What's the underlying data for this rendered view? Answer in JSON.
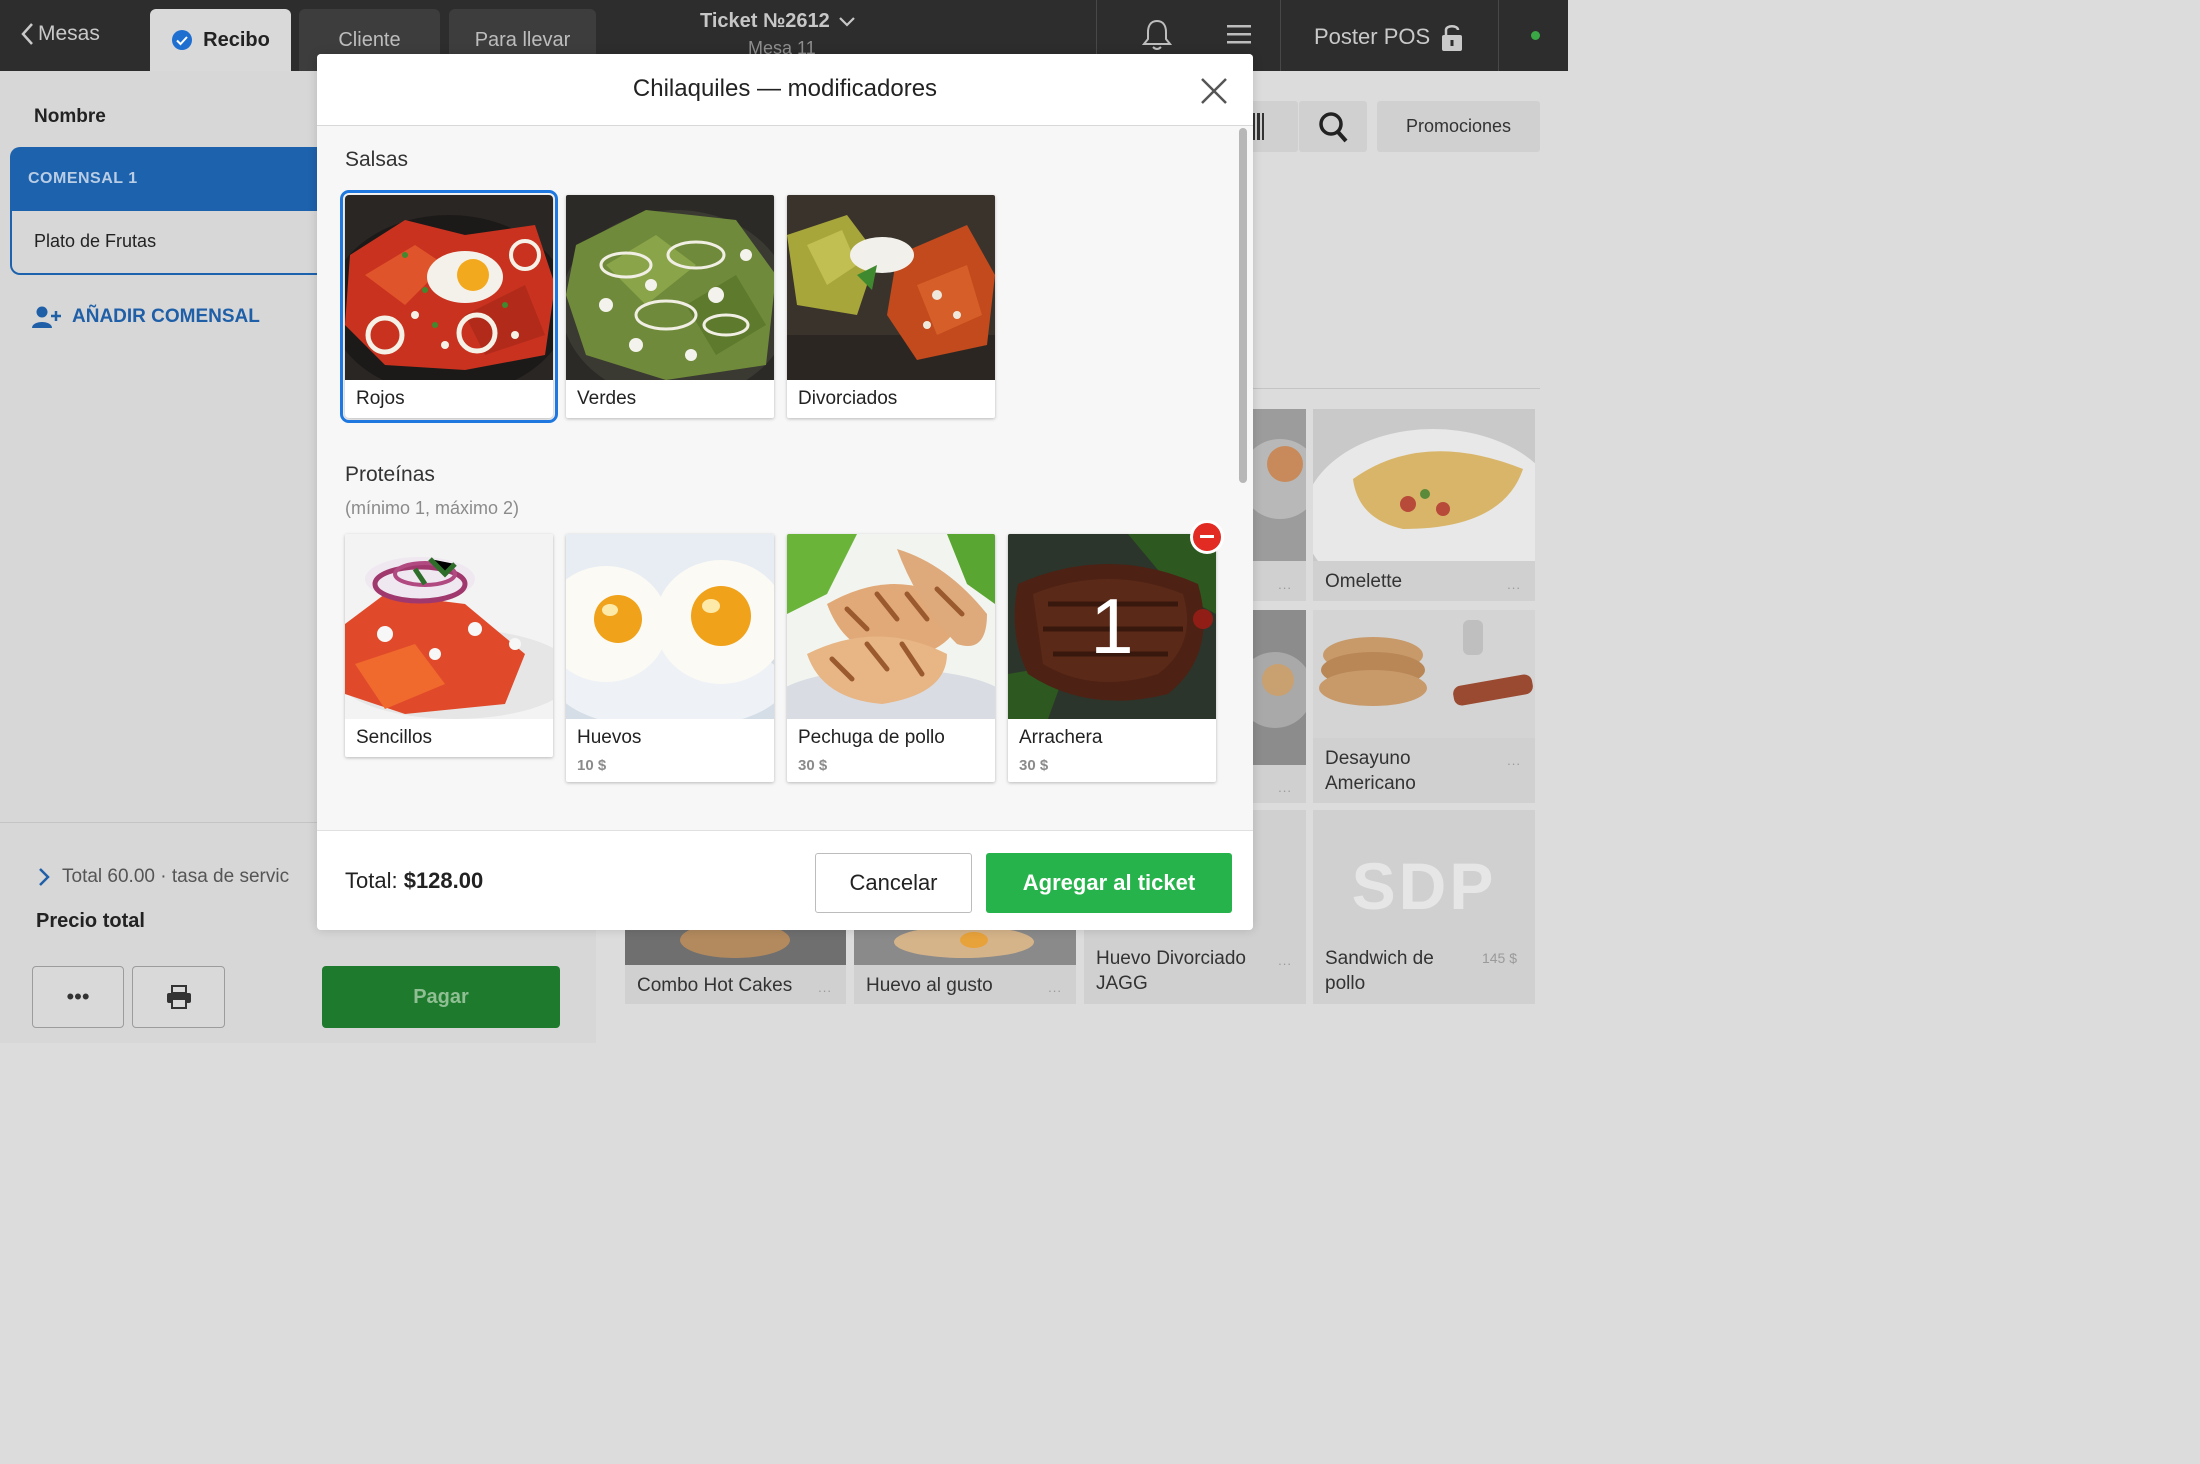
{
  "topbar": {
    "back_label": "Mesas",
    "tabs": [
      {
        "label": "Recibo"
      },
      {
        "label": "Cliente"
      },
      {
        "label": "Para llevar"
      }
    ],
    "ticket_title": "Ticket №2612",
    "ticket_subtitle": "Mesa 11",
    "brand": "Poster POS",
    "status_color": "#39a845"
  },
  "left": {
    "name_label": "Nombre",
    "comensal_header": "COMENSAL 1",
    "comensal_item": "Plato de Frutas",
    "add_comensal": "AÑADIR COMENSAL",
    "total_line": "Total 60.00 · tasa de servic",
    "precio_total": "Precio total",
    "more_label": "•••",
    "pay_label": "Pagar"
  },
  "right": {
    "promotions_label": "Promociones",
    "products": [
      {
        "name": "Omelette",
        "dots": "..."
      },
      {
        "name": "Desayuno Americano",
        "dots": "..."
      },
      {
        "name": "Combo Hot Cakes",
        "dots": "..."
      },
      {
        "name": "Huevo al gusto",
        "dots": "..."
      },
      {
        "name": "Huevo Divorciado JAGG",
        "dots": "..."
      },
      {
        "name": "Sandwich de pollo",
        "price": "145 $",
        "placeholder": "SDP"
      }
    ],
    "partial_dots": "..."
  },
  "modal": {
    "title": "Chilaquiles — modificadores",
    "sections": [
      {
        "title": "Salsas",
        "options": [
          {
            "label": "Rojos",
            "selected": true
          },
          {
            "label": "Verdes"
          },
          {
            "label": "Divorciados"
          }
        ]
      },
      {
        "title": "Proteínas",
        "subtitle": "(mínimo 1, máximo 2)",
        "options": [
          {
            "label": "Sencillos"
          },
          {
            "label": "Huevos",
            "price": "10 $"
          },
          {
            "label": "Pechuga de pollo",
            "price": "30 $"
          },
          {
            "label": "Arrachera",
            "price": "30 $",
            "quantity": "1"
          }
        ]
      }
    ],
    "total_label": "Total:",
    "total_value": "$128.00",
    "cancel_label": "Cancelar",
    "add_label": "Agregar al ticket",
    "accent_color": "#1e78e0",
    "add_color": "#27b34b",
    "remove_badge_color": "#e22b22"
  }
}
